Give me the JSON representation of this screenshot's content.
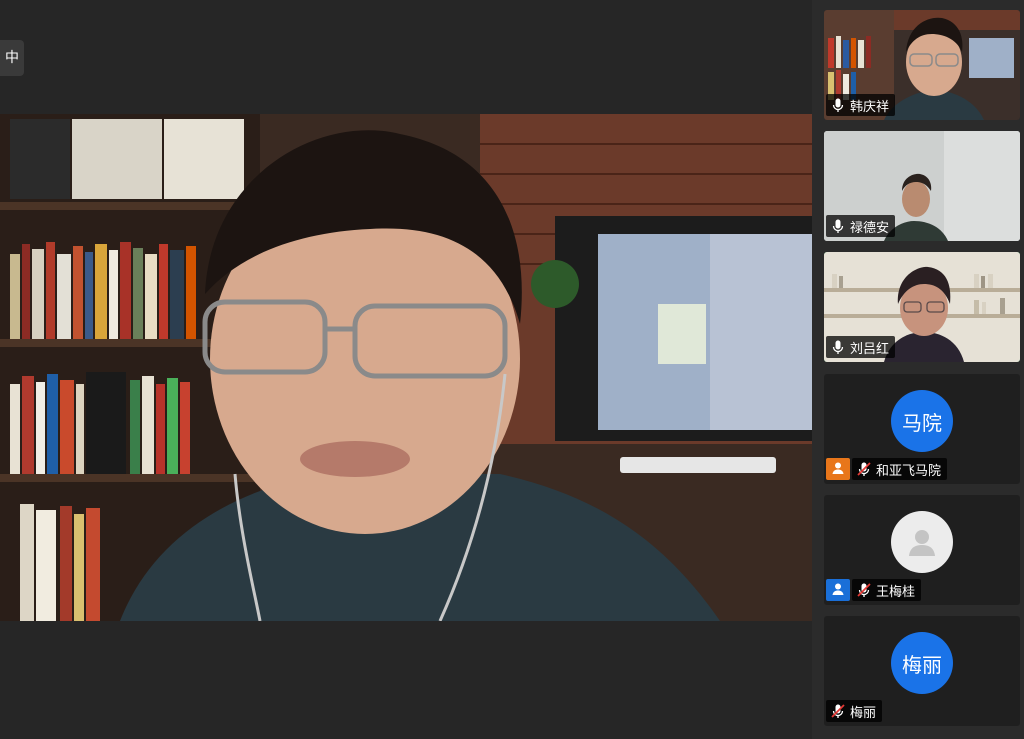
{
  "status_chip": "中",
  "participants": [
    {
      "name": "韩庆祥",
      "mic": "on",
      "type": "video"
    },
    {
      "name": "禄德安",
      "mic": "on",
      "type": "video"
    },
    {
      "name": "刘吕红",
      "mic": "on",
      "type": "video",
      "active_speaker": true
    },
    {
      "name": "和亚飞马院",
      "avatar_text": "马院",
      "mic": "muted",
      "type": "avatar",
      "host_badge": "orange",
      "avatar_color": "#1a73e8"
    },
    {
      "name": "王梅桂",
      "mic": "muted",
      "type": "avatar-default",
      "host_badge": "blue",
      "avatar_color": "#ececec"
    },
    {
      "name": "梅丽",
      "avatar_text": "梅丽",
      "mic": "muted",
      "type": "avatar",
      "avatar_color": "#1a73e8"
    }
  ],
  "colors": {
    "background": "#262626",
    "panel": "#2b2b2b",
    "active_border": "#2ec46b",
    "avatar_blue": "#1a73e8",
    "host_orange": "#e8761a",
    "host_blue": "#1a6fd8"
  }
}
